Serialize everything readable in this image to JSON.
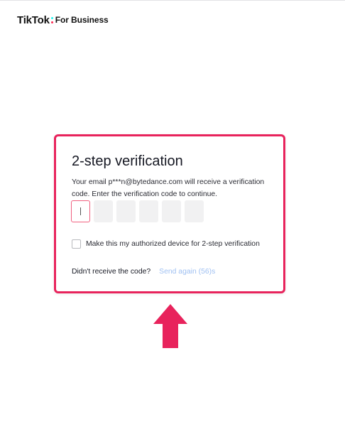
{
  "brand": {
    "logo_main": "TikTok",
    "logo_sub": "For Business",
    "accent_color": "#e8235c"
  },
  "verification": {
    "title": "2-step verification",
    "description": "Your email p***n@bytedance.com will receive a verification code. Enter the verification code to continue.",
    "code_boxes": 6,
    "active_box_index": 0,
    "remember_label": "Make this my authorized device for 2-step verification",
    "remember_checked": false,
    "resend_prompt": "Didn't receive the code?",
    "resend_link": "Send again (56)s"
  },
  "annotation": {
    "arrow_icon": "up-arrow-icon",
    "arrow_color": "#e8235c"
  }
}
